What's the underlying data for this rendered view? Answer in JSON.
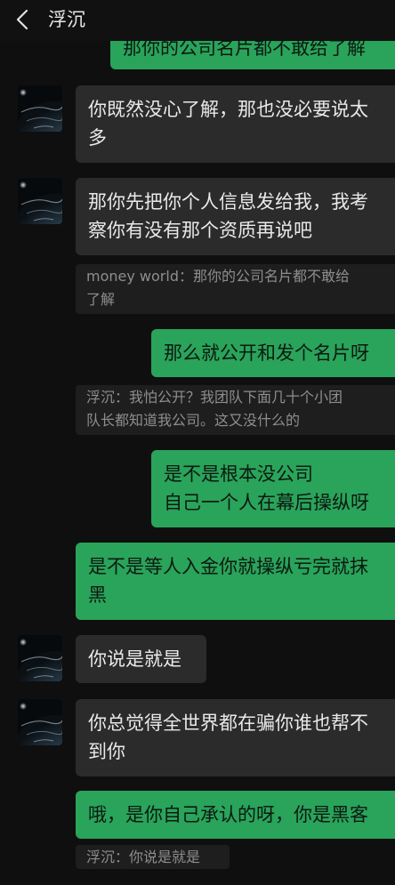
{
  "header": {
    "title": "浮沉"
  },
  "messages": [
    {
      "side": "out",
      "lines": [
        "那你的公司名片都不敢给了解"
      ]
    },
    {
      "side": "in",
      "lines": [
        "你既然没心了解，那也没必要说太",
        "多"
      ]
    },
    {
      "side": "in",
      "lines": [
        "那你先把你个人信息发给我，我考",
        "察你有没有那个资质再说吧"
      ]
    },
    {
      "type": "quote",
      "lines": [
        "money world：那你的公司名片都不敢给",
        "了解"
      ]
    },
    {
      "side": "out",
      "lines": [
        "那么就公开和发个名片呀"
      ]
    },
    {
      "type": "quote",
      "lines": [
        "浮沉：我怕公开？我团队下面几十个小团",
        "队长都知道我公司。这又没什么的"
      ]
    },
    {
      "side": "out",
      "lines": [
        "是不是根本没公司",
        "自己一个人在幕后操纵呀"
      ]
    },
    {
      "side": "out",
      "lines": [
        "是不是等人入金你就操纵亏完就抹",
        "黑"
      ]
    },
    {
      "side": "in",
      "lines": [
        "你说是就是"
      ]
    },
    {
      "side": "in",
      "lines": [
        "你总觉得全世界都在骗你谁也帮不",
        "到你"
      ]
    },
    {
      "side": "out",
      "lines": [
        "哦，是你自己承认的呀，你是黑客"
      ]
    },
    {
      "type": "quote",
      "lines": [
        "浮沉：你说是就是"
      ]
    }
  ],
  "icons": {
    "back": "chevron-left-icon",
    "avatar": "earth-from-space-avatar"
  },
  "colors": {
    "background": "#0f0f0f",
    "incoming_bubble": "#2b2b2b",
    "outgoing_bubble": "#2aa35b",
    "quote_background": "#1e1e1e",
    "quote_text": "#8e8e8e"
  }
}
